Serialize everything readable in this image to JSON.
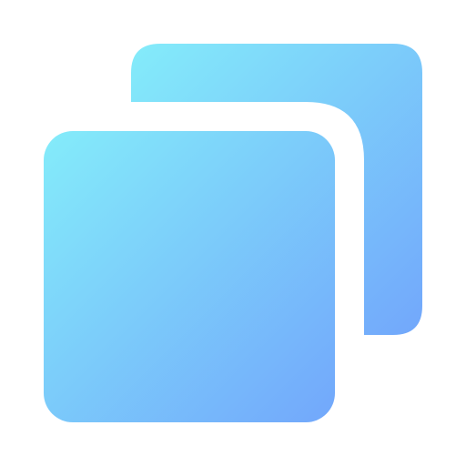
{
  "icon": {
    "name": "copy-icon",
    "colors": {
      "gradient_start": "#84ecfa",
      "gradient_end": "#72a7fb",
      "background": "#ffffff"
    }
  }
}
